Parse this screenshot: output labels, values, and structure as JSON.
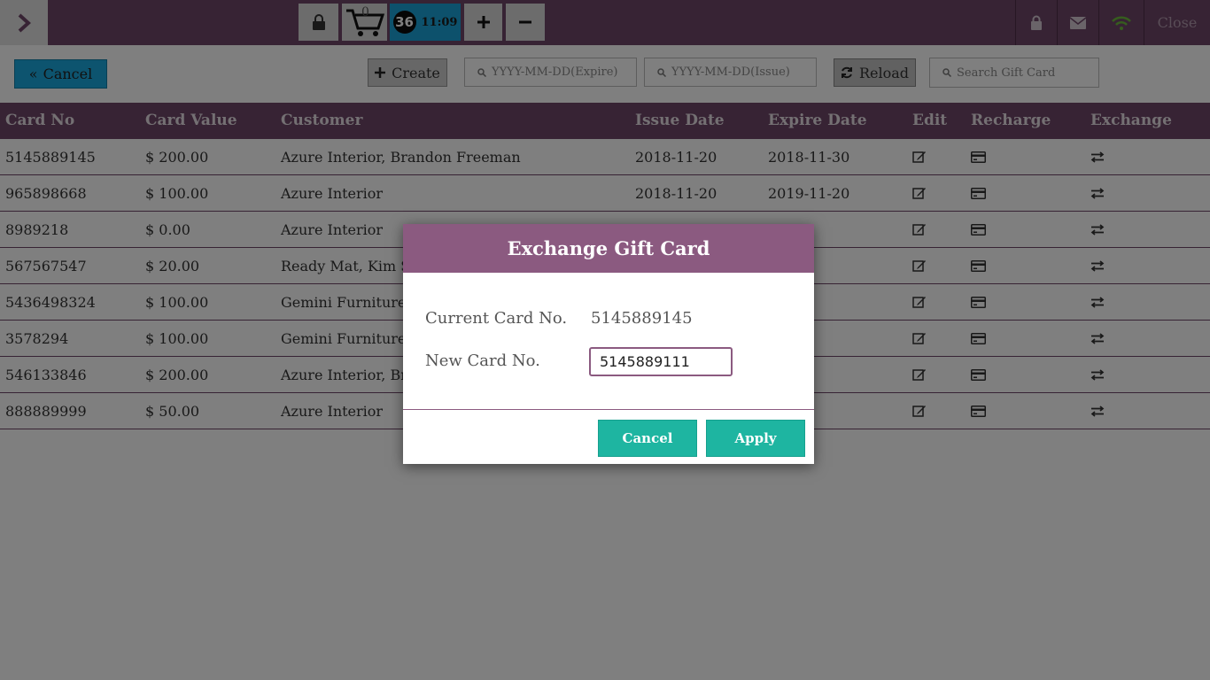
{
  "topbar": {
    "cart_count": "0",
    "order_number": "36",
    "order_time": "11:09",
    "close_label": "Close"
  },
  "toolbar": {
    "cancel_label": "Cancel",
    "create_label": "Create",
    "expire_placeholder": "YYYY-MM-DD(Expire)",
    "issue_placeholder": "YYYY-MM-DD(Issue)",
    "reload_label": "Reload",
    "search_placeholder": "Search Gift Card"
  },
  "table": {
    "headers": [
      "Card No",
      "Card Value",
      "Customer",
      "Issue Date",
      "Expire Date",
      "Edit",
      "Recharge",
      "Exchange"
    ],
    "rows": [
      {
        "card_no": "5145889145",
        "value": "$ 200.00",
        "customer": "Azure Interior, Brandon Freeman",
        "issue": "2018-11-20",
        "expire": "2018-11-30"
      },
      {
        "card_no": "965898668",
        "value": "$ 100.00",
        "customer": "Azure Interior",
        "issue": "2018-11-20",
        "expire": "2019-11-20"
      },
      {
        "card_no": "8989218",
        "value": "$ 0.00",
        "customer": "Azure Interior",
        "issue": "",
        "expire": "1-14"
      },
      {
        "card_no": "567567547",
        "value": "$ 20.00",
        "customer": "Ready Mat, Kim S",
        "issue": "",
        "expire": "1-13"
      },
      {
        "card_no": "5436498324",
        "value": "$ 100.00",
        "customer": "Gemini Furniture",
        "issue": "",
        "expire": "0-18"
      },
      {
        "card_no": "3578294",
        "value": "$ 100.00",
        "customer": "Gemini Furniture",
        "issue": "",
        "expire": "0-18"
      },
      {
        "card_no": "546133846",
        "value": "$ 200.00",
        "customer": "Azure Interior, Br",
        "issue": "",
        "expire": "0-25"
      },
      {
        "card_no": "888889999",
        "value": "$ 50.00",
        "customer": "Azure Interior",
        "issue": "",
        "expire": "1-07"
      }
    ]
  },
  "modal": {
    "title": "Exchange Gift Card",
    "current_label": "Current Card No.",
    "current_value": "5145889145",
    "new_label": "New Card No.",
    "new_value": "5145889111",
    "cancel_label": "Cancel",
    "apply_label": "Apply"
  },
  "colors": {
    "primary": "#6e4768",
    "modal_header": "#8b5a80",
    "action": "#1eb5a1",
    "accent_blue": "#1ba8df"
  }
}
